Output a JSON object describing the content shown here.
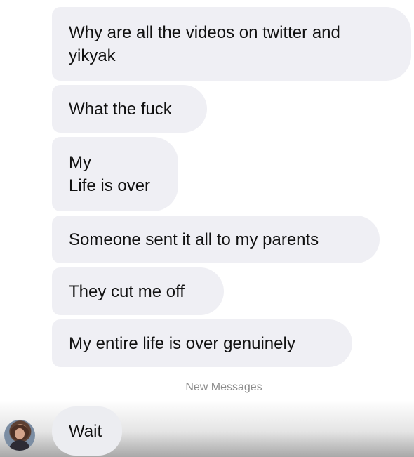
{
  "messages": [
    {
      "text": "Why are all the videos on twitter and\nyikyak"
    },
    {
      "text": "What the fuck"
    },
    {
      "text": "My\nLife is over"
    },
    {
      "text": "Someone sent it all to my parents"
    },
    {
      "text": "They cut me off"
    },
    {
      "text": "My entire life is over genuinely"
    }
  ],
  "divider": {
    "label": "New Messages"
  },
  "new_message": {
    "text": "Wait"
  },
  "colors": {
    "bubble_background": "#efeff4",
    "text": "#111111",
    "divider_text": "#8c8c8c"
  },
  "icons": {
    "sender_avatar": "profile-photo"
  }
}
